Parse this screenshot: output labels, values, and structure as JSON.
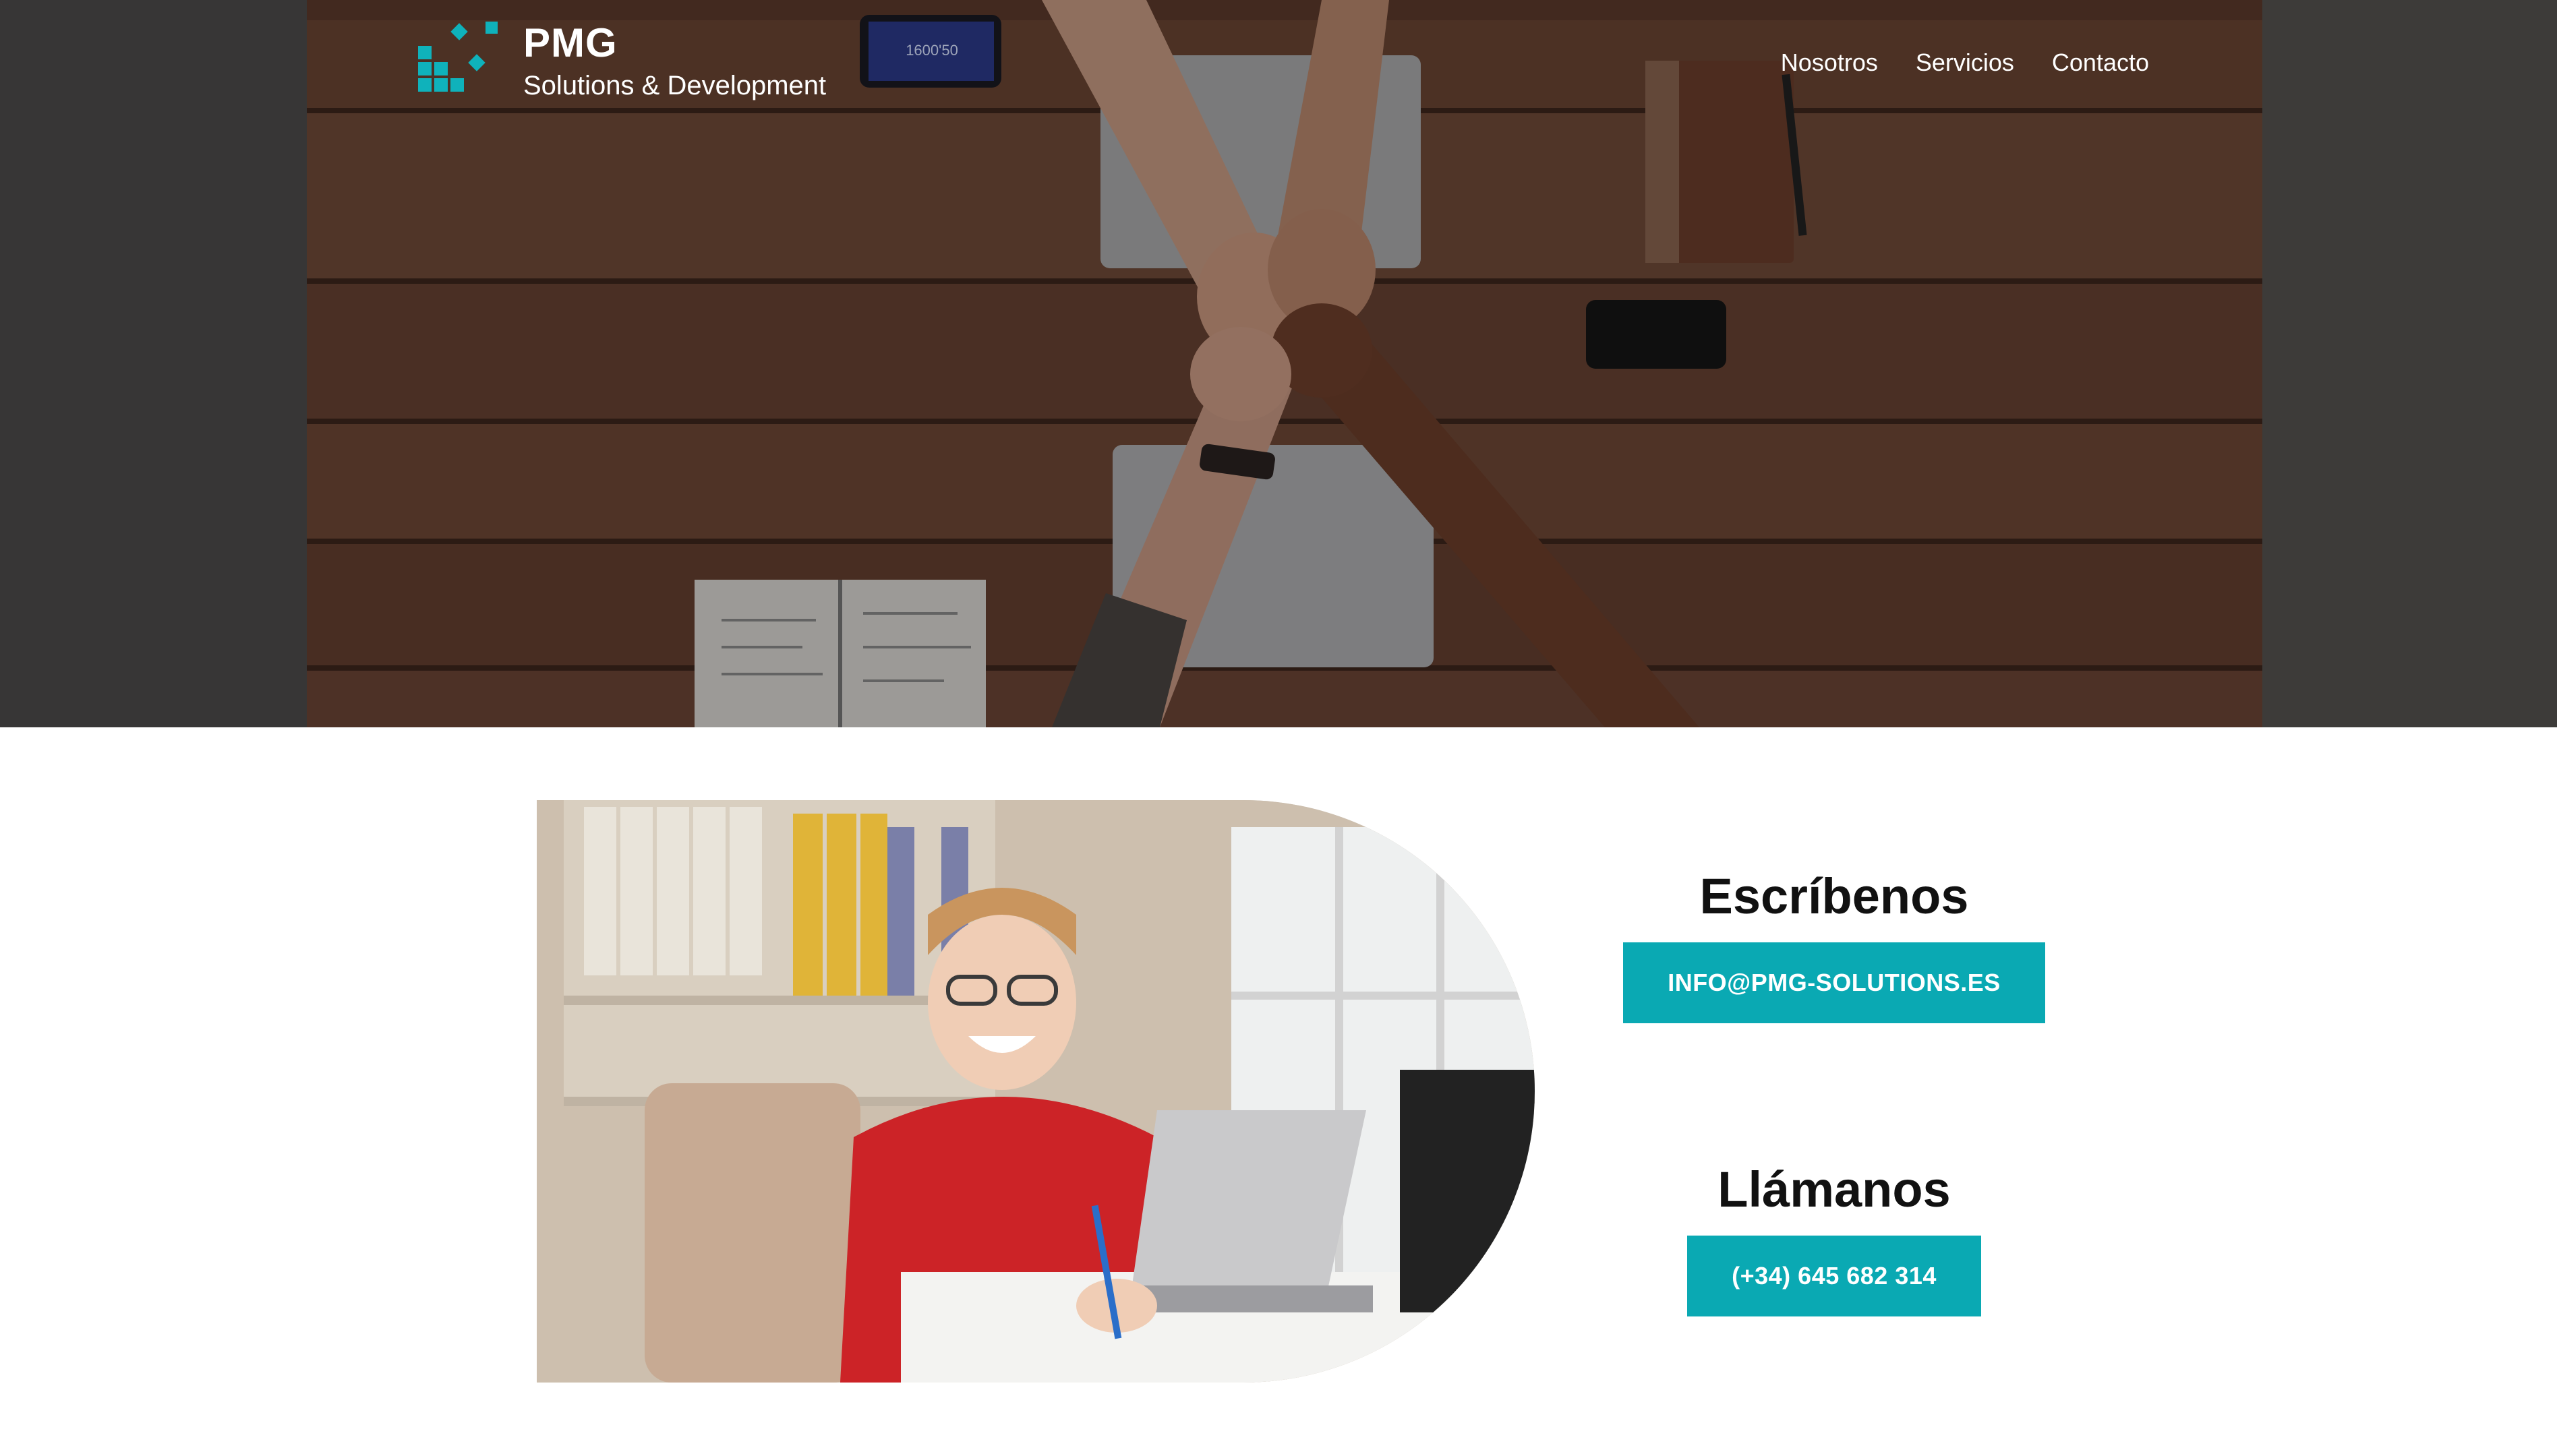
{
  "brand": {
    "name": "PMG",
    "tagline": "Solutions & Development",
    "logo_icon": "pixel-blocks-logo-icon",
    "accent_color": "#0aa9b3"
  },
  "nav": {
    "items": [
      {
        "label": "Nosotros"
      },
      {
        "label": "Servicios"
      },
      {
        "label": "Contacto"
      }
    ]
  },
  "hero": {
    "image": "team-fist-bump-over-desk-photo",
    "phone_screen_text": "1600'50"
  },
  "contact": {
    "image": "smiling-woman-at-laptop-photo",
    "email": {
      "heading": "Escríbenos",
      "button_label": "INFO@PMG-SOLUTIONS.ES"
    },
    "phone": {
      "heading": "Llámanos",
      "button_label": "(+34) 645 682 314"
    }
  }
}
